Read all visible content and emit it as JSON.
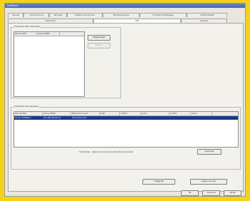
{
  "window": {
    "title": "Indfinacio"
  },
  "tabs_row1": [
    "General",
    "Comunicacions",
    "Marcatge",
    "Catàlech de nombres",
    "Tarifes/permissos",
    "Comptes de Missatges",
    "Confidentialitat"
  ],
  "tabs_row2": [
    "Numeració",
    "NTR",
    "Tragares"
  ],
  "devices_group": {
    "label": "Dispositius XML disponibles",
    "columns": [
      "Nom del NTR",
      "Adreça IP/MAC"
    ],
    "rows": [],
    "add_button": "Afegeix/afegir",
    "remove_button": "Eliminar"
  },
  "numbers_group": {
    "label": "Dispositius XML assignats",
    "columns": [
      "Nom del NTR",
      "Adreça IP/MAC",
      "Mètode de trucada",
      "Prefix",
      "Codifica",
      "Codi 1",
      "Codifica",
      "Codi 2"
    ],
    "rows": [
      [
        "TG-ALI_XYZCB02-2",
        "192.168.100.201.01",
        "TOA bsc/tone ptr ...",
        "",
        "",
        "",
        "",
        ""
      ]
    ],
    "note": "*Ordenades - depèn de la seva línia marcada de dispositiu",
    "delete_button": "Suprimeix"
  },
  "bottom_buttons": {
    "import": "Imatge Nu",
    "export": "Llegeix de maq.",
    "ok": "OK",
    "cancel": "Cancel·la",
    "apply": "Ajuda"
  }
}
